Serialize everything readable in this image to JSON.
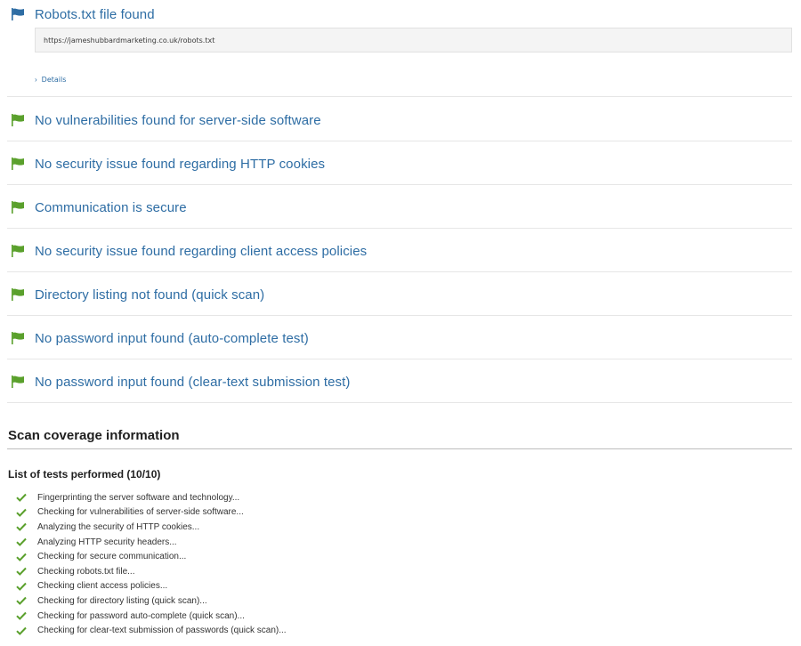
{
  "colors": {
    "blue_flag": "#2e6da4",
    "green_flag": "#5aa02c",
    "link": "#2e6da4",
    "check": "#5aa02c"
  },
  "findings": [
    {
      "title": "Robots.txt file found",
      "flag": "blue-flag-icon",
      "url": "https://jameshubbardmarketing.co.uk/robots.txt",
      "details_label": "Details"
    },
    {
      "title": "No vulnerabilities found for server-side software",
      "flag": "green-flag-icon"
    },
    {
      "title": "No security issue found regarding HTTP cookies",
      "flag": "green-flag-icon"
    },
    {
      "title": "Communication is secure",
      "flag": "green-flag-icon"
    },
    {
      "title": "No security issue found regarding client access policies",
      "flag": "green-flag-icon"
    },
    {
      "title": "Directory listing not found (quick scan)",
      "flag": "green-flag-icon"
    },
    {
      "title": "No password input found (auto-complete test)",
      "flag": "green-flag-icon"
    },
    {
      "title": "No password input found (clear-text submission test)",
      "flag": "green-flag-icon"
    }
  ],
  "coverage": {
    "title": "Scan coverage information",
    "list_title": "List of tests performed (10/10)",
    "tests": [
      "Fingerprinting the server software and technology...",
      "Checking for vulnerabilities of server-side software...",
      "Analyzing the security of HTTP cookies...",
      "Analyzing HTTP security headers...",
      "Checking for secure communication...",
      "Checking robots.txt file...",
      "Checking client access policies...",
      "Checking for directory listing (quick scan)...",
      "Checking for password auto-complete (quick scan)...",
      "Checking for clear-text submission of passwords (quick scan)..."
    ]
  }
}
